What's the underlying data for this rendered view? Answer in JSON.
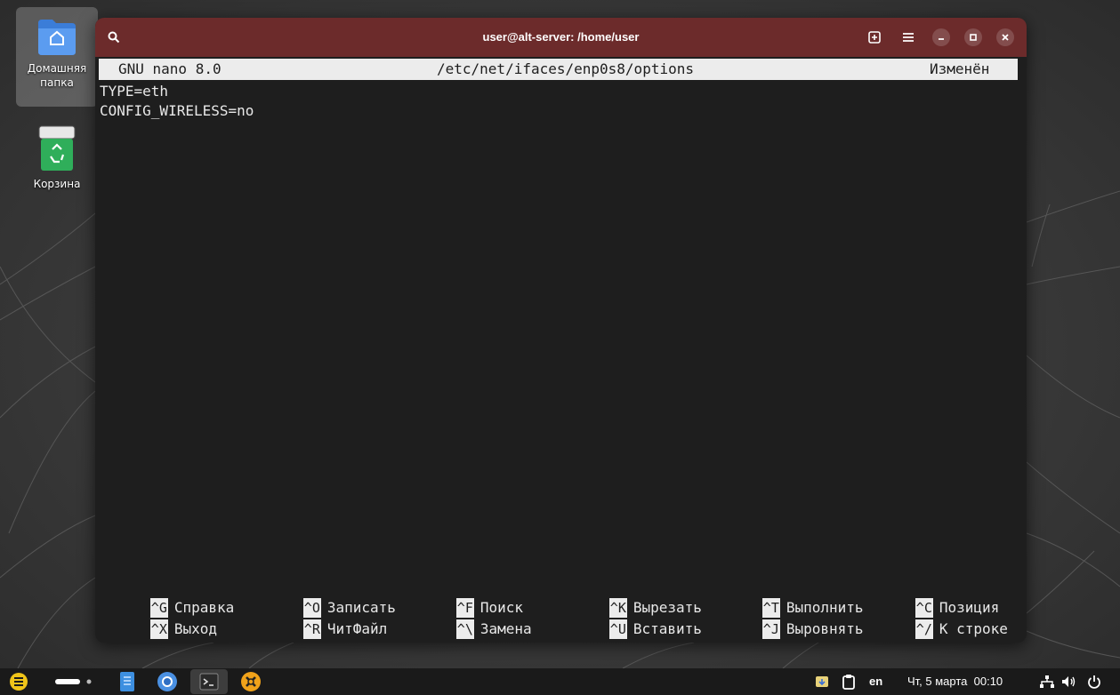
{
  "desktop": {
    "icons": [
      {
        "label_line1": "Домашняя",
        "label_line2": "папка",
        "icon": "home-folder-icon"
      },
      {
        "label": "Корзина",
        "icon": "trash-icon"
      }
    ]
  },
  "terminal": {
    "title": "user@alt-server: /home/user",
    "buttons": [
      "search-icon",
      "new-tab-icon",
      "menu-icon",
      "minimize-icon",
      "maximize-icon",
      "close-icon"
    ],
    "titlebar_color": "#6c2b2b"
  },
  "nano": {
    "header": {
      "version": "GNU nano 8.0",
      "filename": "/etc/net/ifaces/enp0s8/options",
      "status": "Изменён"
    },
    "lines": [
      "TYPE=eth",
      "CONFIG_WIRELESS=no"
    ],
    "shortcuts_row1": [
      {
        "key": "^G",
        "label": "Справка"
      },
      {
        "key": "^O",
        "label": "Записать"
      },
      {
        "key": "^F",
        "label": "Поиск"
      },
      {
        "key": "^K",
        "label": "Вырезать"
      },
      {
        "key": "^T",
        "label": "Выполнить"
      },
      {
        "key": "^C",
        "label": "Позиция"
      }
    ],
    "shortcuts_row2": [
      {
        "key": "^X",
        "label": "Выход"
      },
      {
        "key": "^R",
        "label": "ЧитФайл"
      },
      {
        "key": "^\\",
        "label": "Замена"
      },
      {
        "key": "^U",
        "label": "Вставить"
      },
      {
        "key": "^J",
        "label": "Выровнять"
      },
      {
        "key": "^/",
        "label": "К строке"
      }
    ]
  },
  "taskbar": {
    "apps": [
      "app-menu-icon",
      "workspace-indicator",
      "file-manager-icon",
      "chromium-icon",
      "terminal-icon",
      "settings-tools-icon"
    ],
    "tray": {
      "keyboard_layout": "en",
      "datetime": "Чт, 5 марта  00:10",
      "icons": [
        "updates-icon",
        "clipboard-icon",
        "network-icon",
        "volume-icon",
        "power-icon"
      ]
    }
  }
}
